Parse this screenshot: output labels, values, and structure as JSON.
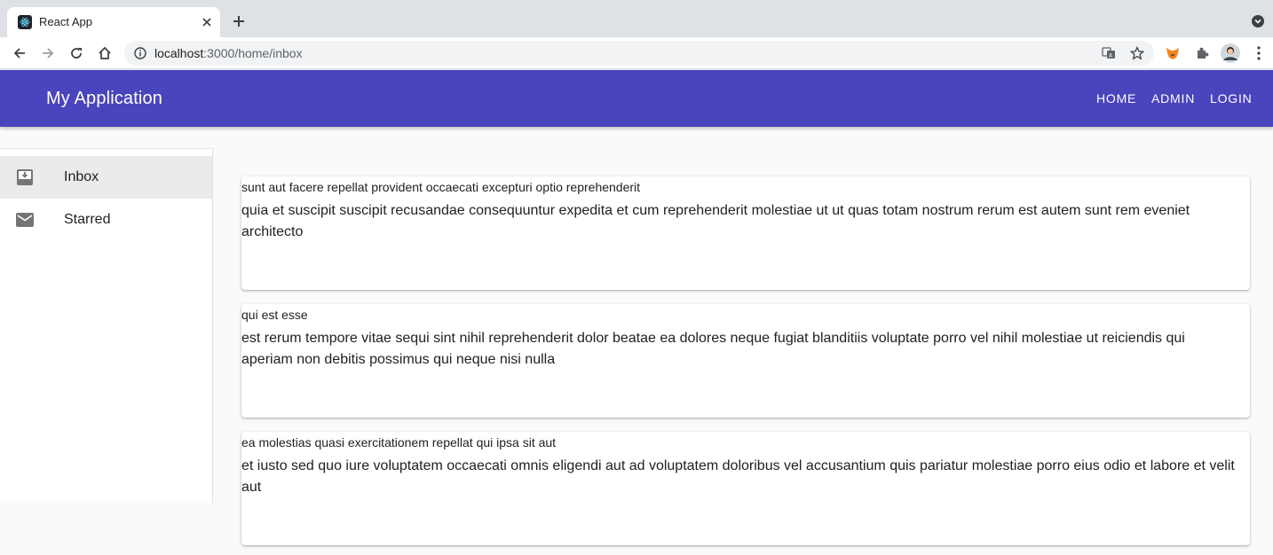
{
  "browser": {
    "tab_title": "React App",
    "url_host": "localhost",
    "url_rest": ":3000/home/inbox",
    "icons": {
      "favicon": "react-logo-icon",
      "tab_close": "close-icon",
      "new_tab": "plus-icon",
      "tab_search": "chevron-down-icon",
      "back": "arrow-left-icon",
      "forward": "arrow-right-icon",
      "reload": "reload-icon",
      "home": "home-icon",
      "site_info": "info-icon",
      "translate": "translate-icon",
      "bookmark": "star-icon",
      "extension_fox": "fox-extension-icon",
      "extensions": "puzzle-icon",
      "profile": "avatar",
      "menu": "kebab-menu-icon"
    }
  },
  "appbar": {
    "title": "My Application",
    "nav": [
      "HOME",
      "ADMIN",
      "LOGIN"
    ],
    "color": "#4a44bd"
  },
  "sidebar": {
    "items": [
      {
        "label": "Inbox",
        "icon": "inbox-icon",
        "selected": true
      },
      {
        "label": "Starred",
        "icon": "mail-icon",
        "selected": false
      }
    ]
  },
  "posts": [
    {
      "title": "sunt aut facere repellat provident occaecati excepturi optio reprehenderit",
      "body": "quia et suscipit suscipit recusandae consequuntur expedita et cum reprehenderit molestiae ut ut quas totam nostrum rerum est autem sunt rem eveniet architecto"
    },
    {
      "title": "qui est esse",
      "body": "est rerum tempore vitae sequi sint nihil reprehenderit dolor beatae ea dolores neque fugiat blanditiis voluptate porro vel nihil molestiae ut reiciendis qui aperiam non debitis possimus qui neque nisi nulla"
    },
    {
      "title": "ea molestias quasi exercitationem repellat qui ipsa sit aut",
      "body": "et iusto sed quo iure voluptatem occaecati omnis eligendi aut ad voluptatem doloribus vel accusantium quis pariatur molestiae porro eius odio et labore et velit aut"
    }
  ]
}
